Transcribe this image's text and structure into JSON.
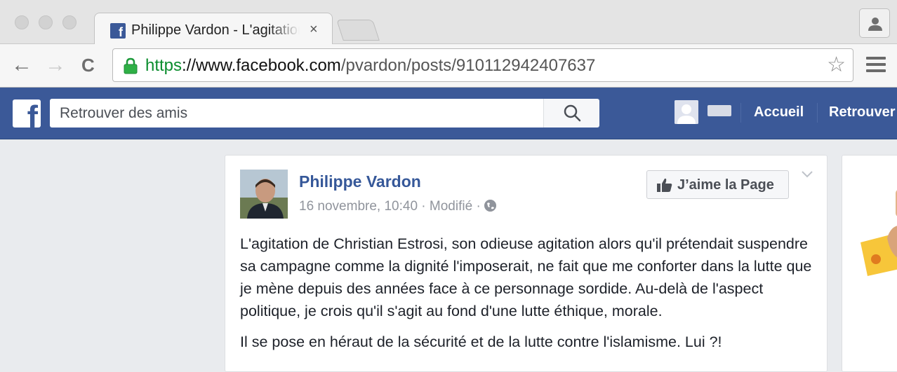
{
  "browser": {
    "tab": {
      "title": "Philippe Vardon - L'agitation de Christian Estrosi",
      "favicon": "facebook-favicon",
      "close": "×"
    },
    "url": {
      "scheme": "https",
      "sep": "://",
      "host": "www.facebook.com",
      "path": "/pvardon/posts/910112942407637"
    },
    "icons": {
      "back": "←",
      "forward": "→",
      "reload": "C",
      "bookmark": "☆"
    }
  },
  "facebook": {
    "search_placeholder": "Retrouver des amis",
    "nav": {
      "home": "Accueil",
      "find_friends": "Retrouver"
    },
    "brand_color": "#3b5998"
  },
  "post": {
    "author": "Philippe Vardon",
    "date": "16 novembre, 10:40",
    "edited": "Modifié",
    "dot": "·",
    "like_page_label": "J’aime la Page",
    "paragraphs": [
      "L'agitation de Christian Estrosi, son odieuse agitation alors qu'il prétendait suspendre sa campagne comme la dignité l'imposerait, ne fait que me conforter dans la lutte que je mène depuis des années face à ce personnage sordide. Au-delà de l'aspect politique, je crois qu'il s'agit au fond d'une lutte éthique, morale.",
      "Il se pose en héraut de la sécurité et de la lutte contre l'islamisme. Lui ?!"
    ]
  }
}
